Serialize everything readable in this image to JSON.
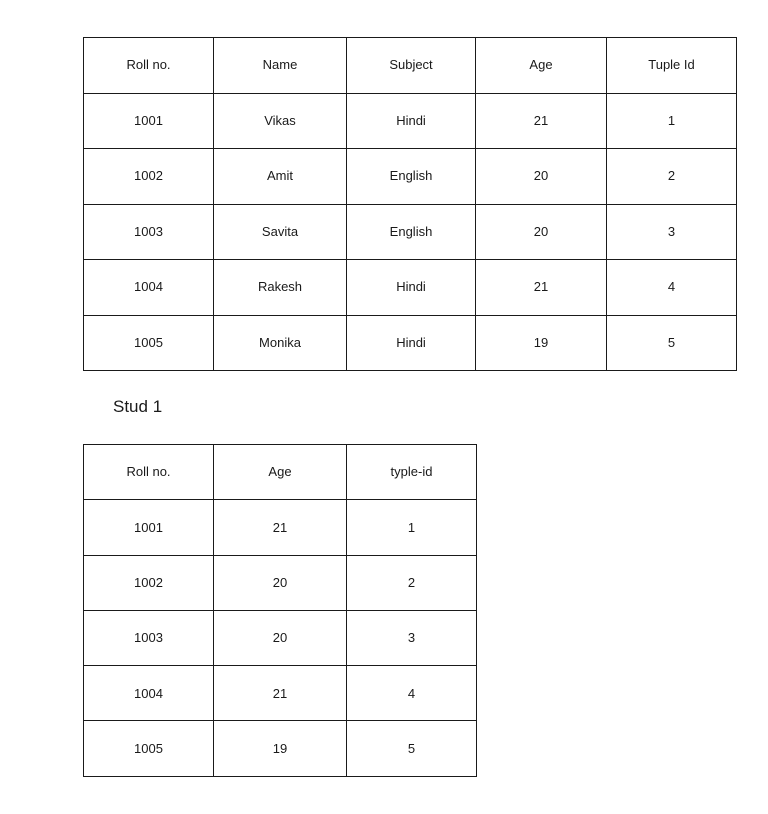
{
  "document": {
    "background_color": "#ffffff",
    "text_color": "#1a1a1a",
    "border_color": "#1a1a1a"
  },
  "tables": [
    {
      "id": "stud-table",
      "name": "stud-relation-table",
      "headers": [
        "Roll no.",
        "Name",
        "Subject",
        "Age",
        "Tuple Id"
      ],
      "rows": [
        [
          "1001",
          "Vikas",
          "Hindi",
          "21",
          "1"
        ],
        [
          "1002",
          "Amit",
          "English",
          "20",
          "2"
        ],
        [
          "1003",
          "Savita",
          "English",
          "20",
          "3"
        ],
        [
          "1004",
          "Rakesh",
          "Hindi",
          "21",
          "4"
        ],
        [
          "1005",
          "Monika",
          "Hindi",
          "19",
          "5"
        ]
      ]
    },
    {
      "id": "projection-table",
      "name": "projection-result-table",
      "headers": [
        "Roll no.",
        "Age",
        "typle-id"
      ],
      "rows": [
        [
          "1001",
          "21",
          "1"
        ],
        [
          "1002",
          "20",
          "2"
        ],
        [
          "1003",
          "20",
          "3"
        ],
        [
          "1004",
          "21",
          "4"
        ],
        [
          "1005",
          "19",
          "5"
        ]
      ]
    }
  ],
  "caption": {
    "label": "Stud 1"
  }
}
